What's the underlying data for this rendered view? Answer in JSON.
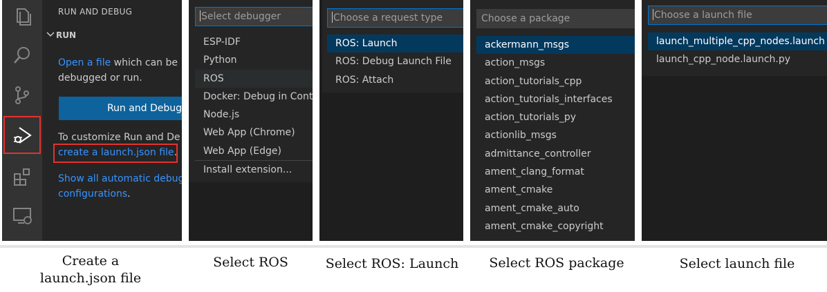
{
  "panel1": {
    "sidebar_title": "RUN AND DEBUG",
    "section": "RUN",
    "open_file_link": "Open a file",
    "open_file_rest": " which can be",
    "open_file_line2": "debugged or run.",
    "run_button": "Run and Debug",
    "customize_text": "To customize Run and De",
    "create_launch_link": "create a launch.json file",
    "create_launch_period": ".",
    "show_link_line1": "Show all automatic debug",
    "show_link_line2": "configurations",
    "show_period": ".",
    "activity_icons": [
      "explorer-icon",
      "search-icon",
      "source-control-icon",
      "run-debug-icon",
      "extensions-icon",
      "remote-explorer-icon"
    ],
    "highlight_color": "#e5322d"
  },
  "panel2": {
    "placeholder": "Select debugger",
    "items": [
      "ESP-IDF",
      "Python",
      "ROS",
      "Docker: Debug in Cont",
      "Node.js",
      "Web App (Chrome)",
      "Web App (Edge)",
      "Install extension..."
    ]
  },
  "panel3": {
    "placeholder": "Choose a request type",
    "items": [
      "ROS: Launch",
      "ROS: Debug Launch File",
      "ROS: Attach"
    ]
  },
  "panel4": {
    "placeholder": "Choose a package",
    "items": [
      "ackermann_msgs",
      "action_msgs",
      "action_tutorials_cpp",
      "action_tutorials_interfaces",
      "action_tutorials_py",
      "actionlib_msgs",
      "admittance_controller",
      "ament_clang_format",
      "ament_cmake",
      "ament_cmake_auto",
      "ament_cmake_copyright"
    ]
  },
  "panel5": {
    "placeholder": "Choose a launch file",
    "items": [
      "launch_multiple_cpp_nodes.launch",
      "launch_cpp_node.launch.py"
    ]
  },
  "captions": {
    "c1_line1": "Create a",
    "c1_line2": "launch.json file",
    "c2": "Select ROS",
    "c3": "Select ROS: Launch",
    "c4": "Select ROS package",
    "c5": "Select launch file"
  }
}
